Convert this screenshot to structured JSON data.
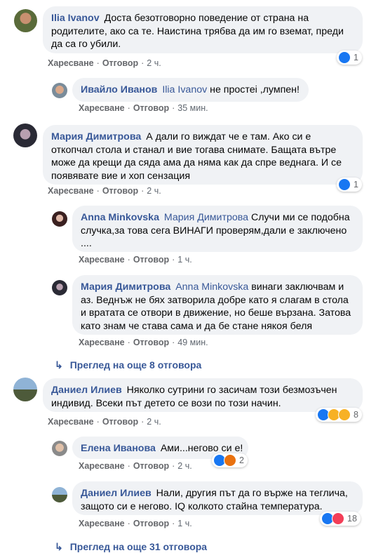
{
  "comments": [
    {
      "author": "Ilia Ivanov",
      "text": "Доста безотговорно поведение от страна на родителите, ако са те. Наистина трябва да им го вземат, преди да са го убили.",
      "like": "Харесване",
      "reply": "Отговор",
      "time": "2 ч.",
      "reaction_count": "1"
    },
    {
      "author": "Ивайло Иванов",
      "mention": "Ilia Ivanov",
      "text": " не простеі ,лумпен!",
      "like": "Харесване",
      "reply": "Отговор",
      "time": "35 мин."
    },
    {
      "author": "Мария Димитрова",
      "text": "А дали го виждат че е там. Ако си е откопчал стола и станал и вие тогава снимате. Бащата вътре може да крещи да сяда ама да няма как да спре веднага. И се появявате вие и хоп сензация",
      "like": "Харесване",
      "reply": "Отговор",
      "time": "2 ч.",
      "reaction_count": "1"
    },
    {
      "author": "Anna Minkovska",
      "mention": "Мария Димитрова",
      "text": " Случи ми се подобна случка,за това сега ВИНАГИ проверям,дали е заключено ....",
      "like": "Харесване",
      "reply": "Отговор",
      "time": "1 ч."
    },
    {
      "author": "Мария Димитрова",
      "mention": "Anna Minkovska",
      "text": " винаги заключвам и аз. Веднъж не бях затворила добре като я слагам в стола и вратата се отвори в движение, но беше вързана. Затова като знам че става сама и да бе стане някоя беля",
      "like": "Харесване",
      "reply": "Отговор",
      "time": "49 мин."
    },
    {
      "more": "Преглед на още 8 отговора"
    },
    {
      "author": "Даниел Илиев",
      "text": "Няколко сутрини го засичам този безмозъчен индивид. Всеки път детето се вози по този начин.",
      "like": "Харесване",
      "reply": "Отговор",
      "time": "2 ч.",
      "reaction_count": "8"
    },
    {
      "author": "Елена Иванова",
      "text": "Ами...негово си е!",
      "like": "Харесване",
      "reply": "Отговор",
      "time": "2 ч.",
      "reaction_count": "2"
    },
    {
      "author": "Даниел Илиев",
      "text": "Нали, другия път да го върже на теглича, защото си е негово. IQ колкото стайна температура.",
      "like": "Харесване",
      "reply": "Отговор",
      "time": "1 ч.",
      "reaction_count": "18"
    },
    {
      "more": "Преглед на още 31 отговора"
    }
  ],
  "colors": {
    "like_blue": "#1877f2",
    "love_red": "#f33e58",
    "wow_yellow": "#f7b125",
    "link_blue": "#385898"
  },
  "icons": [
    "like-icon",
    "angry-icon",
    "wow-icon",
    "sad-icon",
    "haha-icon",
    "reply-arrow-icon"
  ]
}
